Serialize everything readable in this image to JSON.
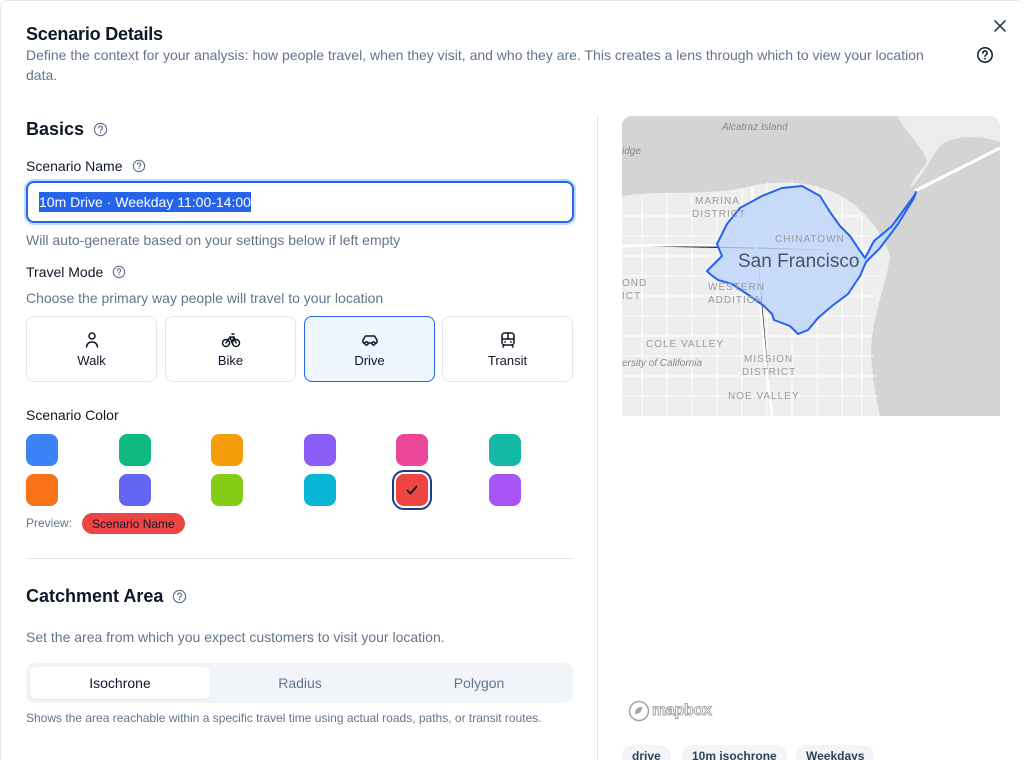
{
  "header": {
    "title": "Scenario Details",
    "subtitle": "Define the context for your analysis: how people travel, when they visit, and who they are. This creates a lens through which to view your location data."
  },
  "basics": {
    "section_title": "Basics",
    "scenario_name_label": "Scenario Name",
    "scenario_name_value": "10m Drive · Weekday 11:00-14:00",
    "scenario_name_hint": "Will auto-generate based on your settings below if left empty",
    "travel_mode_label": "Travel Mode",
    "travel_mode_hint": "Choose the primary way people will travel to your location",
    "travel_modes": [
      {
        "label": "Walk",
        "icon": "walk-icon",
        "selected": false
      },
      {
        "label": "Bike",
        "icon": "bike-icon",
        "selected": false
      },
      {
        "label": "Drive",
        "icon": "car-icon",
        "selected": true
      },
      {
        "label": "Transit",
        "icon": "bus-icon",
        "selected": false
      }
    ],
    "scenario_color_label": "Scenario Color",
    "colors_row1": [
      "#3b82f6",
      "#10b981",
      "#f59e0b",
      "#8b5cf6",
      "#ec4899",
      "#14b8a6"
    ],
    "colors_row2": [
      "#f97316",
      "#6366f1",
      "#84cc16",
      "#06b6d4",
      "#ef4444",
      "#a855f7"
    ],
    "selected_color": "#ef4444",
    "preview_label": "Preview:",
    "preview_pill": "Scenario Name"
  },
  "catchment": {
    "section_title": "Catchment Area",
    "hint": "Set the area from which you expect customers to visit your location.",
    "tabs": [
      "Isochrone",
      "Radius",
      "Polygon"
    ],
    "active_tab": "Isochrone",
    "description": "Shows the area reachable within a specific travel time using actual roads, paths, or transit routes."
  },
  "map": {
    "city": "San Francisco",
    "labels": {
      "alcatraz": "Alcatraz Island",
      "bridge": "idge",
      "marina": "MARINA",
      "district": "DISTRICT",
      "chinatown": "CHINATOWN",
      "ond": "OND",
      "ict": "ICT",
      "western": "WESTERN",
      "addition": "ADDITION",
      "cole_valley": "COLE VALLEY",
      "university": "ersity of California",
      "mission": "MISSION",
      "mission_district": "DISTRICT",
      "noe_valley": "NOE VALLEY"
    },
    "attribution": "mapbox",
    "isochrone_color": "#3b82f6"
  },
  "summary_tags": [
    "drive",
    "10m isochrone",
    "Weekdays"
  ]
}
